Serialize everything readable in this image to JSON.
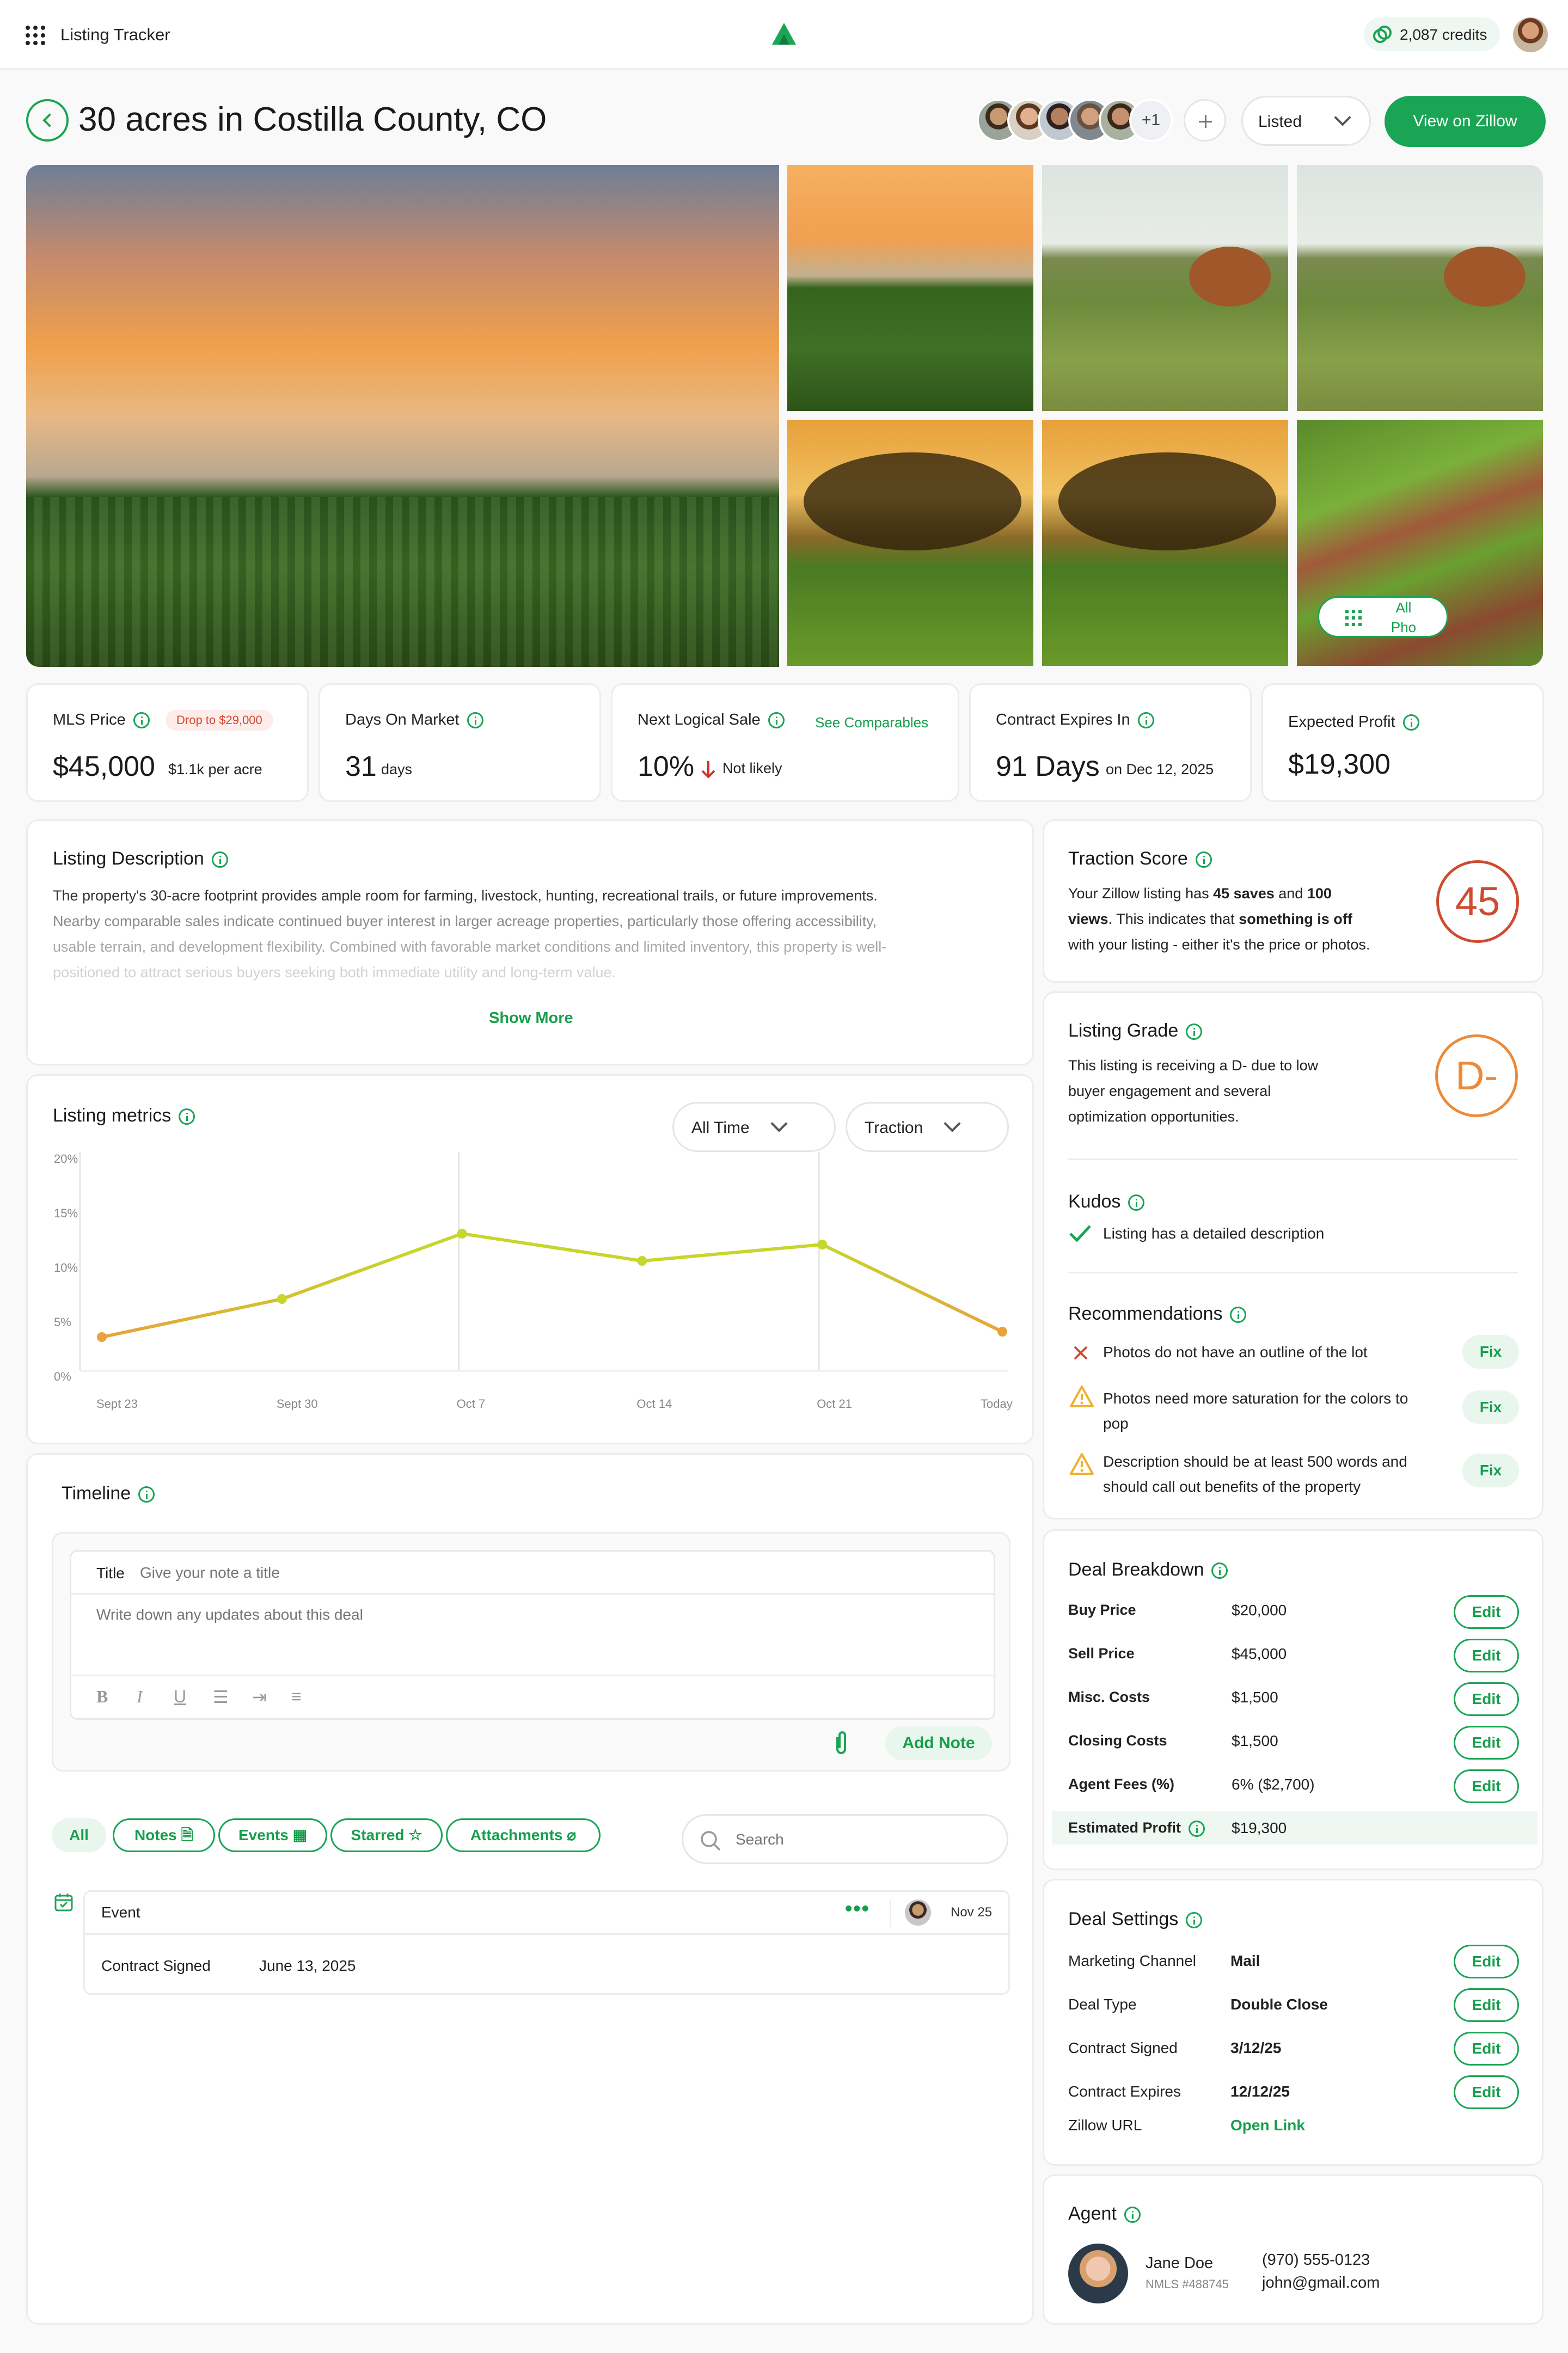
{
  "header": {
    "app_title": "Listing Tracker",
    "credits": "2,087 credits"
  },
  "page": {
    "title": "30 acres in Costilla County, CO",
    "collaborators_more": "+1",
    "status": "Listed",
    "zillow_button": "View on Zillow",
    "all_photos": "All Pho"
  },
  "stats": {
    "mls": {
      "label": "MLS Price",
      "badge": "Drop to $29,000",
      "value": "$45,000",
      "sub": "$1.1k per acre"
    },
    "dom": {
      "label": "Days On Market",
      "value": "31",
      "sub": "days"
    },
    "nls": {
      "label": "Next Logical Sale",
      "link": "See Comparables",
      "value": "10%",
      "sub": "Not likely"
    },
    "contract": {
      "label": "Contract Expires In",
      "value": "91 Days",
      "sub": "on Dec 12, 2025"
    },
    "profit": {
      "label": "Expected Profit",
      "value": "$19,300"
    }
  },
  "description": {
    "title": "Listing Description",
    "lines": [
      "The property's 30-acre footprint provides ample room for farming, livestock, hunting, recreational trails, or future improvements.",
      "Nearby comparable sales indicate continued buyer interest in larger acreage properties, particularly those offering accessibility,",
      "usable terrain, and development flexibility. Combined with favorable market conditions and limited inventory, this property is well-",
      "positioned to attract serious buyers seeking both immediate utility and long-term value."
    ],
    "show_more": "Show More"
  },
  "metrics": {
    "title": "Listing metrics",
    "range": "All Time",
    "metric": "Traction"
  },
  "chart_data": {
    "type": "line",
    "x": [
      "Sept 23",
      "Sept 30",
      "Oct 7",
      "Oct 14",
      "Oct 21",
      "Today"
    ],
    "values": [
      3,
      6.5,
      12.5,
      10,
      11.5,
      3.5
    ],
    "y_ticks": [
      "20%",
      "15%",
      "10%",
      "5%",
      "0%"
    ],
    "ylim": [
      0,
      20
    ],
    "colors": {
      "line": "#c6d62c",
      "low": "#e8a33a"
    }
  },
  "timeline": {
    "title": "Timeline",
    "note_title_label": "Title",
    "note_title_placeholder": "Give your note a title",
    "note_body_placeholder": "Write down any updates about this deal",
    "add_note": "Add Note",
    "filters": [
      "All",
      "Notes",
      "Events",
      "Starred",
      "Attachments"
    ],
    "search_placeholder": "Search",
    "event": {
      "type": "Event",
      "date": "Nov 25",
      "label": "Contract Signed",
      "value": "June 13, 2025"
    }
  },
  "traction": {
    "title": "Traction Score",
    "score": "45",
    "t1": "Your Zillow listing has ",
    "b1": "45 saves",
    "t2": " and ",
    "b2": "100",
    "b3": "views",
    "t3": ". This indicates that ",
    "b4": "something is off",
    "t4": "with your listing - either it's the price or photos."
  },
  "grade": {
    "title": "Listing Grade",
    "grade": "D-",
    "lines": [
      "This listing is receiving a D- due to low",
      "buyer engagement and several",
      "optimization opportunities."
    ],
    "kudos_title": "Kudos",
    "kudos": [
      "Listing has a detailed description"
    ],
    "rec_title": "Recommendations",
    "recs": [
      {
        "l1": "Photos do not have an outline of the lot",
        "l2": ""
      },
      {
        "l1": "Photos need more saturation for the colors to",
        "l2": "pop"
      },
      {
        "l1": "Description should be at least 500 words and",
        "l2": "should call out benefits of the property"
      }
    ],
    "fix": "Fix"
  },
  "deal": {
    "title": "Deal Breakdown",
    "edit": "Edit",
    "rows": [
      {
        "label": "Buy Price",
        "value": "$20,000"
      },
      {
        "label": "Sell Price",
        "value": "$45,000"
      },
      {
        "label": "Misc. Costs",
        "value": "$1,500"
      },
      {
        "label": "Closing Costs",
        "value": "$1,500"
      },
      {
        "label": "Agent Fees (%)",
        "value": "6% ($2,700)"
      }
    ],
    "est_label": "Estimated Profit",
    "est_value": "$19,300"
  },
  "settings": {
    "title": "Deal Settings",
    "rows": [
      {
        "label": "Marketing Channel",
        "value": "Mail"
      },
      {
        "label": "Deal Type",
        "value": "Double Close"
      },
      {
        "label": "Contract Signed",
        "value": "3/12/25"
      },
      {
        "label": "Contract Expires",
        "value": "12/12/25"
      }
    ],
    "url_label": "Zillow URL",
    "url_value": "Open Link"
  },
  "agent": {
    "title": "Agent",
    "name": "Jane Doe",
    "nmls": "NMLS #488745",
    "phone": "(970) 555-0123",
    "email": "john@gmail.com"
  }
}
